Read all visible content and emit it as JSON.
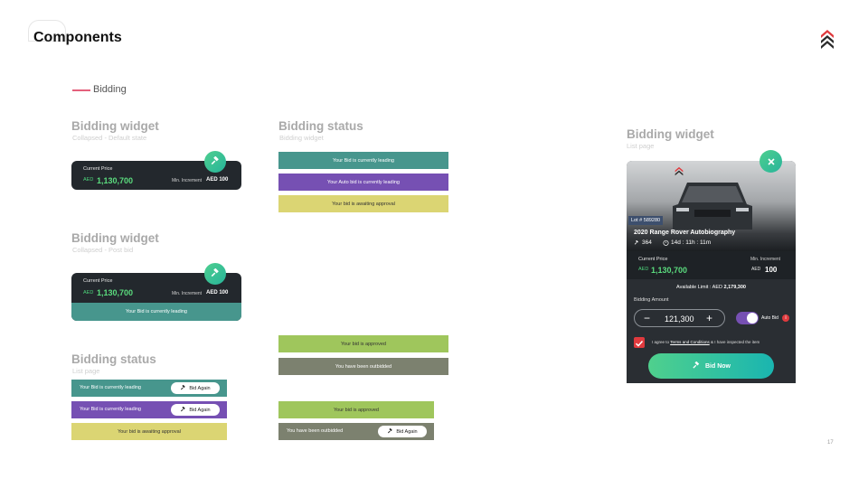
{
  "page": {
    "title": "Components",
    "section": "Bidding",
    "page_number": "17"
  },
  "widget_default": {
    "title": "Bidding widget",
    "subtitle": "Collapsed - Default state",
    "current_price_label": "Current Price",
    "currency": "AED",
    "price": "1,130,700",
    "min_increment_label": "Min. Increment",
    "min_increment_value": "AED 100"
  },
  "widget_post": {
    "title": "Bidding widget",
    "subtitle": "Collapsed - Post bid",
    "current_price_label": "Current Price",
    "currency": "AED",
    "price": "1,130,700",
    "min_increment_label": "Min. Increment",
    "min_increment_value": "AED 100",
    "status": "Your Bid is currently leading"
  },
  "status_list": {
    "title": "Bidding status",
    "subtitle": "List page",
    "leading": "Your Bid is currently leading",
    "auto_leading": "Your Bid is currently leading",
    "awaiting": "Your bid is awaiting approval",
    "bid_again": "Bid Again"
  },
  "status_widget": {
    "title": "Bidding status",
    "subtitle": "Bidding widget",
    "leading": "Your Bid is currently leading",
    "auto_leading": "Your Auto bid is currently leading",
    "awaiting": "Your bid is awaiting approval",
    "approved": "Your bid is approved",
    "outbidded": "You have been outbidded"
  },
  "status_small": {
    "approved": "Your bid is approved",
    "outbidded": "You have been outbidded",
    "bid_again": "Bid Again"
  },
  "widget_list": {
    "title": "Bidding widget",
    "subtitle": "List page",
    "lot": "Lot # 589280",
    "car_name": "2020 Range Rover Autobiography",
    "bids": "364",
    "time_left": "14d : 11h : 11m",
    "current_price_label": "Current Price",
    "currency": "AED",
    "price": "1,130,700",
    "min_increment_label": "Min. Increment",
    "min_currency": "AED",
    "min_value": "100",
    "available_limit_label": "Available Limit : AED",
    "available_limit": "2,179,300",
    "bidding_amount_label": "Bidding Amount",
    "amount": "121,300",
    "auto_bid": "Auto Bid",
    "terms_prefix": "I agree to",
    "terms_link": "Terms and Conditions",
    "terms_suffix": "& I have inspected the item",
    "bid_now": "Bid Now"
  },
  "colors": {
    "teal": "#47968d",
    "purple": "#7650b3",
    "yellow": "#dbd573",
    "green": "#9fc65c",
    "grey": "#7c816f",
    "accent_pink": "#e4607c",
    "brand_red": "#e03a3e"
  }
}
